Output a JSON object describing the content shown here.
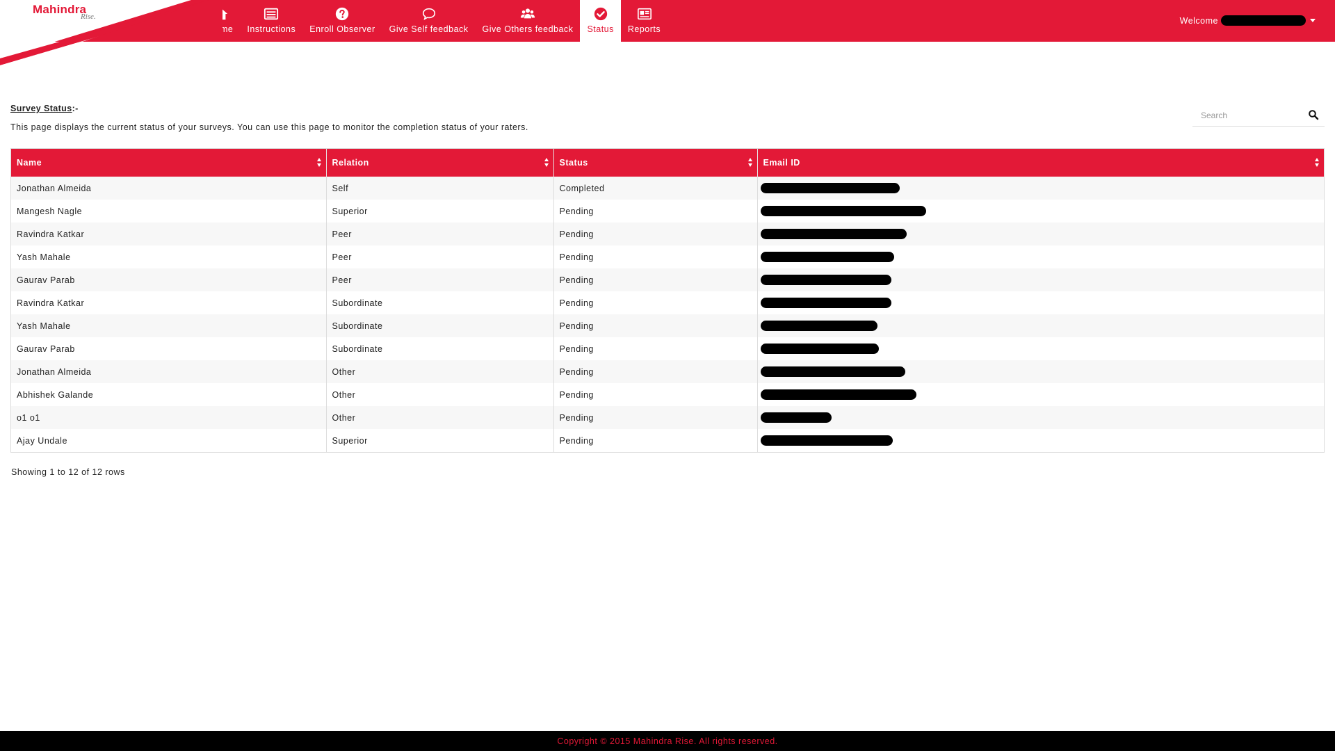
{
  "brand": {
    "name": "Mahindra",
    "tagline": "Rise.",
    "color": "#e31937"
  },
  "nav": {
    "items": [
      {
        "label": "Home",
        "icon": "home-icon"
      },
      {
        "label": "Instructions",
        "icon": "list-icon"
      },
      {
        "label": "Enroll Observer",
        "icon": "question-icon"
      },
      {
        "label": "Give Self feedback",
        "icon": "chat-bubble-icon"
      },
      {
        "label": "Give Others feedback",
        "icon": "users-icon"
      },
      {
        "label": "Status",
        "icon": "check-circle-icon",
        "active": true
      },
      {
        "label": "Reports",
        "icon": "newspaper-icon"
      }
    ],
    "welcome_label": "Welcome"
  },
  "page": {
    "title": "Survey Status",
    "title_suffix": ":-",
    "description": "This page displays the current status of your surveys. You can use this page to monitor the completion status of your raters."
  },
  "search": {
    "placeholder": "Search"
  },
  "table": {
    "columns": [
      "Name",
      "Relation",
      "Status",
      "Email ID"
    ],
    "rows": [
      {
        "name": "Jonathan Almeida",
        "relation": "Self",
        "status": "Completed"
      },
      {
        "name": "Mangesh Nagle",
        "relation": "Superior",
        "status": "Pending"
      },
      {
        "name": "Ravindra Katkar",
        "relation": "Peer",
        "status": "Pending"
      },
      {
        "name": "Yash Mahale",
        "relation": "Peer",
        "status": "Pending"
      },
      {
        "name": "Gaurav Parab",
        "relation": "Peer",
        "status": "Pending"
      },
      {
        "name": "Ravindra Katkar",
        "relation": "Subordinate",
        "status": "Pending"
      },
      {
        "name": "Yash Mahale",
        "relation": "Subordinate",
        "status": "Pending"
      },
      {
        "name": "Gaurav Parab",
        "relation": "Subordinate",
        "status": "Pending"
      },
      {
        "name": "Jonathan Almeida",
        "relation": "Other",
        "status": "Pending"
      },
      {
        "name": "Abhishek Galande",
        "relation": "Other",
        "status": "Pending"
      },
      {
        "name": "o1 o1",
        "relation": "Other",
        "status": "Pending"
      },
      {
        "name": "Ajay Undale",
        "relation": "Superior",
        "status": "Pending"
      }
    ]
  },
  "pagination": {
    "summary": "Showing 1 to 12 of 12 rows"
  },
  "footer": {
    "copyright": "Copyright © 2015 Mahindra Rise. All rights reserved."
  }
}
